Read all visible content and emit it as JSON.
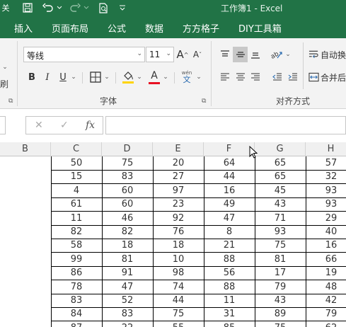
{
  "titlebar": {
    "autosave_fragment": "关",
    "title": "工作簿1 - Excel"
  },
  "tabs": [
    "插入",
    "页面布局",
    "公式",
    "数据",
    "方方格子",
    "DIY工具箱"
  ],
  "ribbon": {
    "left_fragment": "刷",
    "font_name": "等线",
    "font_size": "11",
    "grow_font": "A",
    "shrink_font": "A",
    "bold": "B",
    "italic": "I",
    "underline": "U",
    "font_color_letter": "A",
    "phonetic_top": "wén",
    "phonetic_bottom": "文",
    "font_group_label": "字体",
    "align_group_label": "对齐方式",
    "wrap_text": "自动换",
    "merge_center": "合并后",
    "font_color_hex": "#e81123",
    "fill_color_hex": "#ffd400"
  },
  "formula_bar": {
    "cancel": "✕",
    "enter": "✓",
    "fx": "fx",
    "value": ""
  },
  "columns": [
    "B",
    "C",
    "D",
    "E",
    "F",
    "G",
    "H"
  ],
  "rows": [
    [
      "",
      "50",
      "75",
      "20",
      "64",
      "65",
      "57"
    ],
    [
      "",
      "15",
      "83",
      "27",
      "44",
      "65",
      "32"
    ],
    [
      "",
      "4",
      "60",
      "97",
      "16",
      "45",
      "93"
    ],
    [
      "",
      "61",
      "60",
      "23",
      "49",
      "43",
      "93"
    ],
    [
      "",
      "11",
      "46",
      "92",
      "47",
      "71",
      "29"
    ],
    [
      "",
      "82",
      "82",
      "76",
      "8",
      "93",
      "40"
    ],
    [
      "",
      "58",
      "18",
      "18",
      "21",
      "75",
      "16"
    ],
    [
      "",
      "99",
      "81",
      "10",
      "88",
      "81",
      "66"
    ],
    [
      "",
      "86",
      "91",
      "98",
      "56",
      "17",
      "19"
    ],
    [
      "",
      "78",
      "47",
      "74",
      "88",
      "79",
      "48"
    ],
    [
      "",
      "83",
      "52",
      "44",
      "11",
      "43",
      "42"
    ],
    [
      "",
      "84",
      "83",
      "75",
      "31",
      "89",
      "79"
    ],
    [
      "",
      "87",
      "22",
      "55",
      "85",
      "75",
      "62"
    ]
  ]
}
